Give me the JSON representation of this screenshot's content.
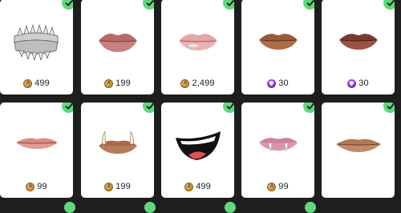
{
  "colors": {
    "background": "#1e1e1e",
    "card": "#ffffff",
    "owned_check": "#5fd87a",
    "coin": "#c6903f",
    "gem": "#7a2fe0"
  },
  "items": [
    {
      "name": "fangs-teeth",
      "currency": "coin",
      "price": "499",
      "owned": true
    },
    {
      "name": "full-pink-lips",
      "currency": "coin",
      "price": "199",
      "owned": true
    },
    {
      "name": "glossy-pink-lips",
      "currency": "coin",
      "price": "2,499",
      "owned": true
    },
    {
      "name": "brown-lips",
      "currency": "gem",
      "price": "30",
      "owned": true
    },
    {
      "name": "dark-brown-lips",
      "currency": "gem",
      "price": "30",
      "owned": true
    },
    {
      "name": "thin-pink-lips",
      "currency": "coin",
      "price": "99",
      "owned": true
    },
    {
      "name": "tusk-lips",
      "currency": "coin",
      "price": "199",
      "owned": true
    },
    {
      "name": "cartoon-smile",
      "currency": "coin",
      "price": "499",
      "owned": true
    },
    {
      "name": "vampire-lips",
      "currency": "coin",
      "price": "99",
      "owned": true
    },
    {
      "name": "tan-lips",
      "currency": "coin",
      "price": "",
      "owned": true
    }
  ]
}
